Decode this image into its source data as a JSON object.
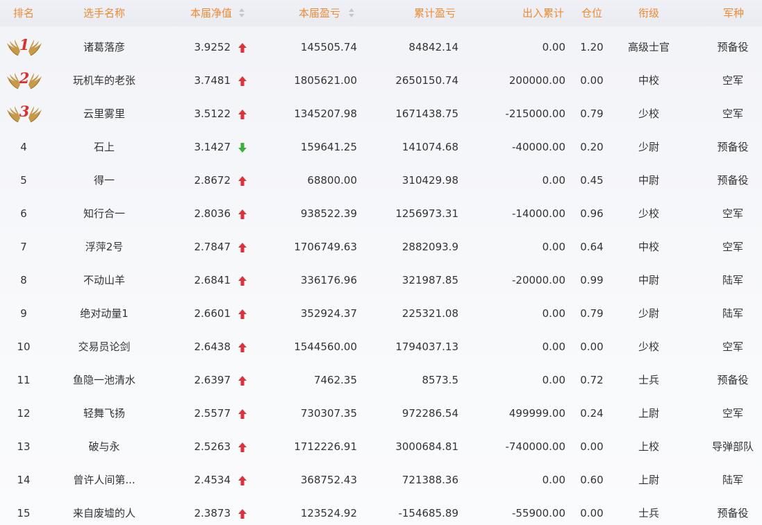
{
  "colors": {
    "header_text": "#f08a32",
    "up_arrow": "#e0303a",
    "down_arrow": "#3dad3d",
    "medal_number": "#d9312b",
    "wing": "#c79a4a"
  },
  "headers": {
    "rank": "排名",
    "player": "选手名称",
    "nav": "本届净值",
    "profit": "本届盈亏",
    "cum_profit": "累计盈亏",
    "io_total": "出入累计",
    "position": "仓位",
    "title": "衔级",
    "branch": "军种"
  },
  "rows": [
    {
      "rank": "1",
      "medal": true,
      "name": "诸葛落彦",
      "nav": "3.9252",
      "trend": "up",
      "profit": "145505.74",
      "cum": "84842.14",
      "io": "0.00",
      "pos": "1.20",
      "title": "高级士官",
      "branch": "预备役"
    },
    {
      "rank": "2",
      "medal": true,
      "name": "玩机车的老张",
      "nav": "3.7481",
      "trend": "up",
      "profit": "1805621.00",
      "cum": "2650150.74",
      "io": "200000.00",
      "pos": "0.00",
      "title": "中校",
      "branch": "空军"
    },
    {
      "rank": "3",
      "medal": true,
      "name": "云里雾里",
      "nav": "3.5122",
      "trend": "up",
      "profit": "1345207.98",
      "cum": "1671438.75",
      "io": "-215000.00",
      "pos": "0.79",
      "title": "少校",
      "branch": "空军"
    },
    {
      "rank": "4",
      "medal": false,
      "name": "石上",
      "nav": "3.1427",
      "trend": "down",
      "profit": "159641.25",
      "cum": "141074.68",
      "io": "-40000.00",
      "pos": "0.20",
      "title": "少尉",
      "branch": "预备役"
    },
    {
      "rank": "5",
      "medal": false,
      "name": "得一",
      "nav": "2.8672",
      "trend": "up",
      "profit": "68800.00",
      "cum": "310429.98",
      "io": "0.00",
      "pos": "0.45",
      "title": "中尉",
      "branch": "预备役"
    },
    {
      "rank": "6",
      "medal": false,
      "name": "知行合一",
      "nav": "2.8036",
      "trend": "up",
      "profit": "938522.39",
      "cum": "1256973.31",
      "io": "-14000.00",
      "pos": "0.96",
      "title": "少校",
      "branch": "空军"
    },
    {
      "rank": "7",
      "medal": false,
      "name": "浮萍2号",
      "nav": "2.7847",
      "trend": "up",
      "profit": "1706749.63",
      "cum": "2882093.9",
      "io": "0.00",
      "pos": "0.64",
      "title": "中校",
      "branch": "空军"
    },
    {
      "rank": "8",
      "medal": false,
      "name": "不动山羊",
      "nav": "2.6841",
      "trend": "up",
      "profit": "336176.96",
      "cum": "321987.85",
      "io": "-20000.00",
      "pos": "0.99",
      "title": "中尉",
      "branch": "陆军"
    },
    {
      "rank": "9",
      "medal": false,
      "name": "绝对动量1",
      "nav": "2.6601",
      "trend": "up",
      "profit": "352924.37",
      "cum": "225321.08",
      "io": "0.00",
      "pos": "0.79",
      "title": "少尉",
      "branch": "陆军"
    },
    {
      "rank": "10",
      "medal": false,
      "name": "交易员论剑",
      "nav": "2.6438",
      "trend": "up",
      "profit": "1544560.00",
      "cum": "1794037.13",
      "io": "0.00",
      "pos": "0.00",
      "title": "少校",
      "branch": "空军"
    },
    {
      "rank": "11",
      "medal": false,
      "name": "鱼隐一池清水",
      "nav": "2.6397",
      "trend": "up",
      "profit": "7462.35",
      "cum": "8573.5",
      "io": "0.00",
      "pos": "0.72",
      "title": "士兵",
      "branch": "预备役"
    },
    {
      "rank": "12",
      "medal": false,
      "name": "轻舞飞扬",
      "nav": "2.5577",
      "trend": "up",
      "profit": "730307.35",
      "cum": "972286.54",
      "io": "499999.00",
      "pos": "0.24",
      "title": "上尉",
      "branch": "空军"
    },
    {
      "rank": "13",
      "medal": false,
      "name": "破与永",
      "nav": "2.5263",
      "trend": "up",
      "profit": "1712226.91",
      "cum": "3000684.81",
      "io": "-740000.00",
      "pos": "0.00",
      "title": "上校",
      "branch": "导弹部队"
    },
    {
      "rank": "14",
      "medal": false,
      "name": "曾许人间第...",
      "nav": "2.4534",
      "trend": "up",
      "profit": "368752.43",
      "cum": "721388.36",
      "io": "0.00",
      "pos": "0.60",
      "title": "上尉",
      "branch": "陆军"
    },
    {
      "rank": "15",
      "medal": false,
      "name": "来自废墟的人",
      "nav": "2.3873",
      "trend": "up",
      "profit": "123524.92",
      "cum": "-154685.89",
      "io": "-55900.00",
      "pos": "0.00",
      "title": "士兵",
      "branch": "预备役"
    }
  ]
}
